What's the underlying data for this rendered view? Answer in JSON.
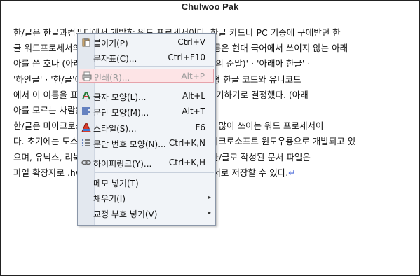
{
  "window": {
    "title": "Chulwoo Pak"
  },
  "document": {
    "lines": [
      "한/글은 한글과컴퓨터에서 개발한 워드 프로세서이다. 한글 카드나 PC 기종에 구애받던 한",
      "글 워드프로세서의 표준을 바꾸어 놓았다. 한글 단어 이름은 현대 국어에서 쓰이지 않는 아래",
      "아를 쓴 호나 (아래아 한글, Hangul Word Processor의 준말)' · '아래아 한글' ·",
      "'하안글' · '한/글'이라 읽게 되었으나, 국가 표준인 완성형 한글 코드와 유니코드",
      "에서 이 이름을 표현할 수 없어 아래아부터 한/글로도 표기하기로 결정했다. (아래",
      "아를 모르는 사람은 '한/글'이라고 읽기도 한다.)",
      "한/글은 마이크로소프트 워드와 함께 대한민국에서 가장 많이 쓰이는 워드 프로세서이",
      "다. 초기에는 도스용으로 개발되었으나 현재는 주로 마이크로소프트 윈도우용으로 개발되고 있",
      "으며, 유닉스, 리눅스 용으로 발표되어 제작되어 있다. 한/글로 작성된 문서 파일은",
      "파일 확장자로 .hwp를 쓰며, .hwt를 사용하여 양식 문서로 저장할 수 있다."
    ],
    "para_mark": "↵"
  },
  "context_menu": {
    "items": [
      {
        "label": "붙이기(P)",
        "shortcut": "Ctrl+V",
        "icon": "paste-icon"
      },
      {
        "label": "문자표(C)...",
        "shortcut": "Ctrl+F10",
        "icon": ""
      },
      {
        "label": "인쇄(R)...",
        "shortcut": "Alt+P",
        "icon": "print-icon"
      },
      {
        "label": "글자 모양(L)...",
        "shortcut": "Alt+L",
        "icon": "char-shape-icon"
      },
      {
        "label": "문단 모양(M)...",
        "shortcut": "Alt+T",
        "icon": "paragraph-shape-icon"
      },
      {
        "label": "스타일(S)...",
        "shortcut": "F6",
        "icon": "style-icon"
      },
      {
        "label": "문단 번호 모양(N)...",
        "shortcut": "Ctrl+K,N",
        "icon": "numbering-icon"
      },
      {
        "label": "하이퍼링크(Y)...",
        "shortcut": "Ctrl+K,H",
        "icon": "hyperlink-icon"
      },
      {
        "label": "메모 넣기(T)",
        "shortcut": "",
        "icon": ""
      },
      {
        "label": "채우기(I)",
        "shortcut": "",
        "icon": "",
        "submenu": true
      },
      {
        "label": "교정 부호 넣기(V)",
        "shortcut": "",
        "icon": "",
        "submenu": true
      }
    ]
  },
  "colors": {
    "highlight": "#fde4e6",
    "para_mark": "#4d6bd9"
  }
}
